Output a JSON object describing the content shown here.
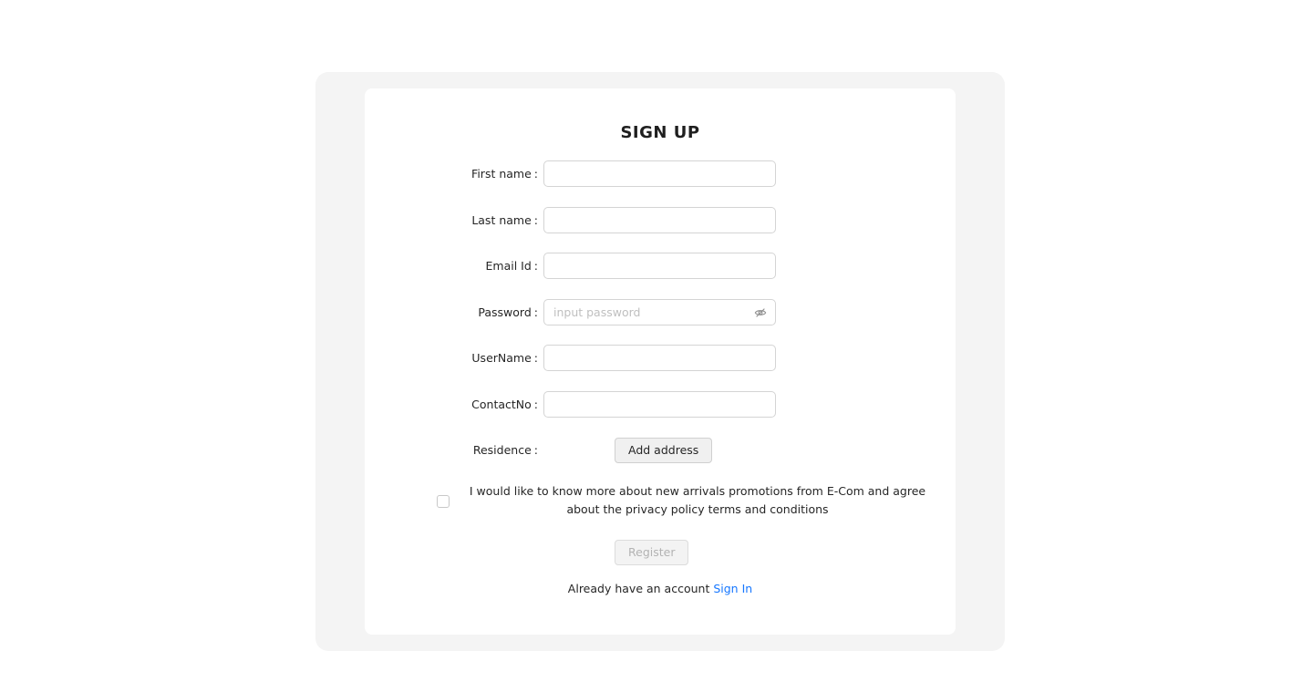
{
  "form": {
    "title": "SIGN UP",
    "colon": ":",
    "fields": {
      "first_name": {
        "label": "First name",
        "value": ""
      },
      "last_name": {
        "label": "Last name",
        "value": ""
      },
      "email": {
        "label": "Email Id",
        "value": ""
      },
      "password": {
        "label": "Password",
        "value": "",
        "placeholder": "input password"
      },
      "username": {
        "label": "UserName",
        "value": ""
      },
      "contact": {
        "label": "ContactNo",
        "value": ""
      },
      "residence": {
        "label": "Residence",
        "button_label": "Add address"
      }
    },
    "consent": {
      "checked": false,
      "text": "I would like to know more about new arrivals promotions from E-Com and agree about the privacy policy terms and conditions"
    },
    "register_label": "Register",
    "footer": {
      "prompt": "Already have an account",
      "link_label": "Sign In"
    }
  },
  "icons": {
    "password_toggle": "eye-invisible-icon"
  },
  "colors": {
    "link": "#1677ff",
    "panel_bg": "#f4f4f4",
    "card_bg": "#ffffff"
  }
}
